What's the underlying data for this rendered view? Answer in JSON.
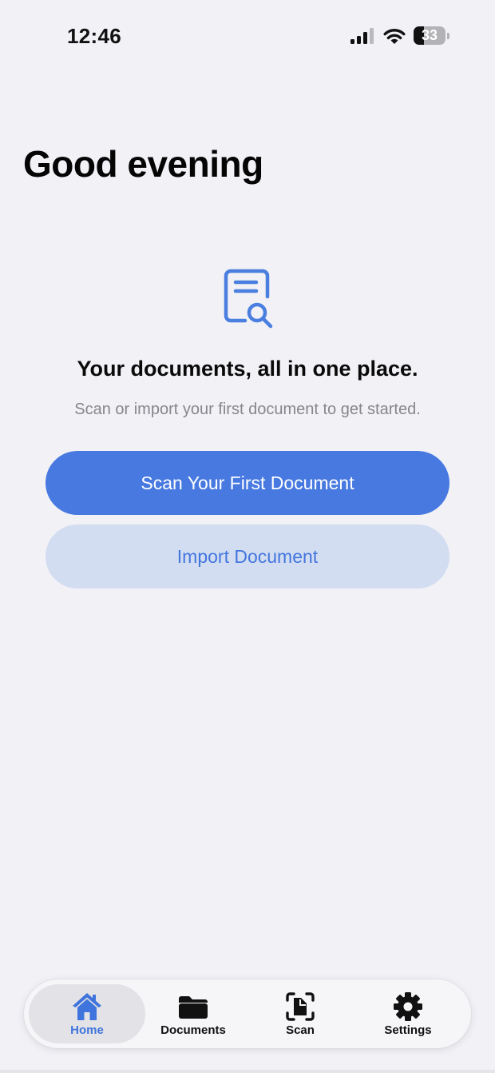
{
  "status_bar": {
    "time": "12:46",
    "battery_level": 33
  },
  "header": {
    "title": "Good evening"
  },
  "empty_state": {
    "icon": "document-search-icon",
    "headline": "Your documents, all in one place.",
    "subtitle": "Scan or import your first document to get started."
  },
  "actions": {
    "primary_label": "Scan Your First Document",
    "secondary_label": "Import Document"
  },
  "tab_bar": {
    "active_tab": "Home",
    "items": [
      {
        "label": "Home",
        "icon": "house-icon"
      },
      {
        "label": "Documents",
        "icon": "folder-icon"
      },
      {
        "label": "Scan",
        "icon": "doc-viewfinder-icon"
      },
      {
        "label": "Settings",
        "icon": "gear-icon"
      }
    ]
  },
  "colors": {
    "accent": "#4779e0",
    "secondary_button_bg": "#d3ddf1",
    "background": "#f1f1f6",
    "subtitle_text": "#86868b"
  }
}
